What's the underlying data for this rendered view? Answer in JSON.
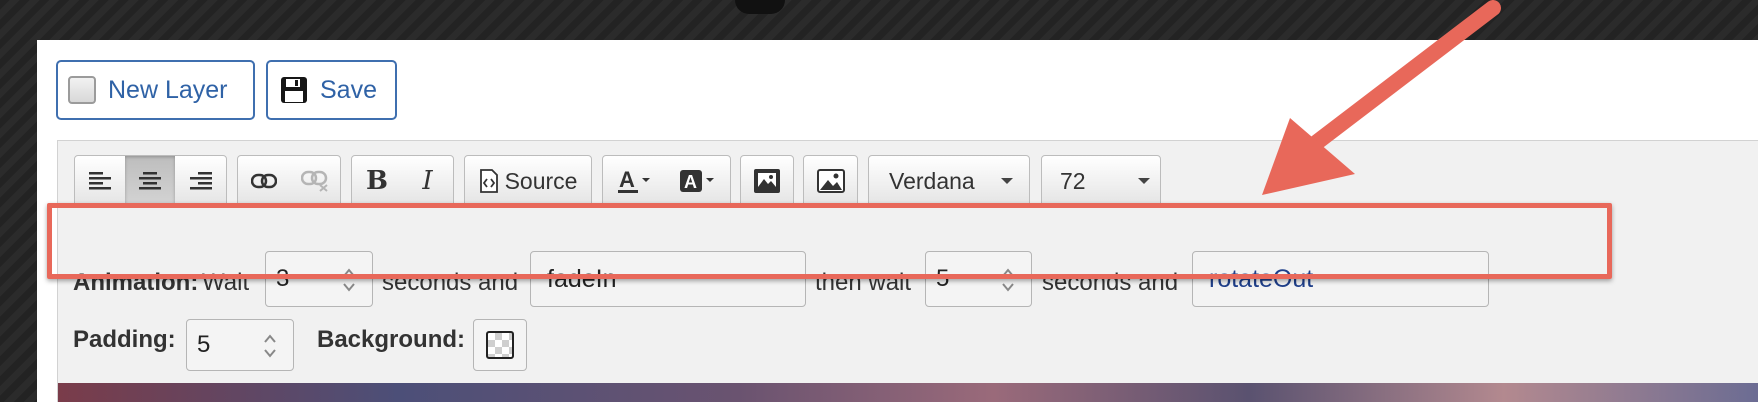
{
  "toolbar_top": {
    "new_layer_label": "New Layer",
    "save_label": "Save"
  },
  "editor_toolbar": {
    "alignment_buttons": [
      "align-left",
      "align-center",
      "align-right"
    ],
    "source_label": "Source",
    "font_family": "Verdana",
    "font_size": "72"
  },
  "animation": {
    "label": "Animation:",
    "wait_label": "Wait",
    "wait_seconds": "3",
    "seconds_and_label": "seconds and",
    "first_effect": "fadeIn",
    "then_wait_label": "then wait",
    "then_seconds": "5",
    "seconds_and_label_2": "seconds and",
    "second_effect": "rotateOut"
  },
  "padding": {
    "label": "Padding:",
    "value": "5"
  },
  "background": {
    "label": "Background:"
  },
  "colors": {
    "accent_blue": "#2f62a6",
    "highlight_red": "#e8685a",
    "second_effect_text": "#1f3f8a"
  }
}
